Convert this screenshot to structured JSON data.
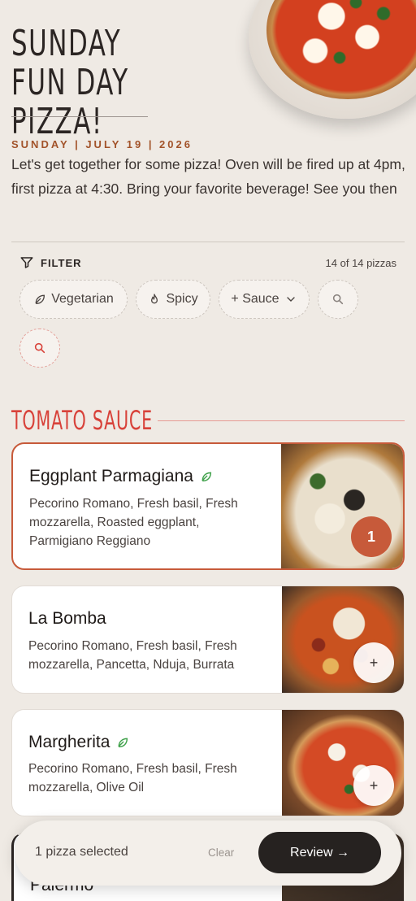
{
  "hero": {
    "title": "SUNDAY FUN DAY PIZZA!",
    "date": "SUNDAY | JULY 19 | 2026",
    "description": "Let's get together for some pizza! Oven will be fired up at 4pm, first pizza at 4:30. Bring your favorite beverage! See you then"
  },
  "filter": {
    "label": "FILTER",
    "count": "14 of 14 pizzas",
    "chips": {
      "vegetarian": "Vegetarian",
      "spicy": "Spicy",
      "sauce": "+ Sauce"
    }
  },
  "section": {
    "title": "TOMATO SAUCE"
  },
  "pizzas": [
    {
      "name": "Eggplant Parmagiana",
      "vegetarian": true,
      "ingredients": "Pecorino Romano, Fresh basil, Fresh mozzarella, Roasted eggplant, Parmigiano Reggiano",
      "quantity": "1",
      "selected": true
    },
    {
      "name": "La Bomba",
      "vegetarian": false,
      "ingredients": "Pecorino Romano, Fresh basil, Fresh mozzarella, Pancetta, Nduja, Burrata",
      "add_label": "+"
    },
    {
      "name": "Margherita",
      "vegetarian": true,
      "ingredients": "Pecorino Romano, Fresh basil, Fresh mozzarella, Olive Oil",
      "add_label": "+"
    },
    {
      "name": "Palermo"
    }
  ],
  "bottom_bar": {
    "selected_text": "1 pizza selected",
    "clear_label": "Clear",
    "review_label": "Review →"
  },
  "colors": {
    "accent": "#c75a3a",
    "section": "#d8423a",
    "background": "#efeae4",
    "leaf": "#3fa14a"
  }
}
